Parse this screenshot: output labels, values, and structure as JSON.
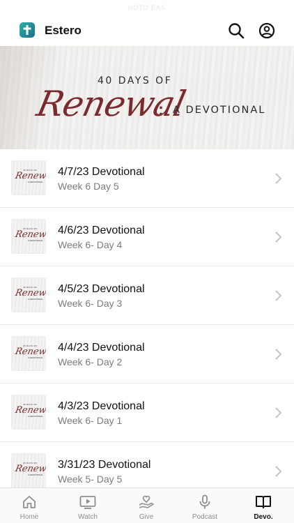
{
  "status_bar": {
    "text": "HOTO EAS"
  },
  "header": {
    "app_title": "Estero",
    "logo_icon": "cross-logo-icon",
    "search_icon": "search-icon",
    "profile_icon": "person-circle-icon"
  },
  "hero": {
    "top_text": "40 DAYS OF",
    "script_text": "Renewal",
    "colon": ":",
    "sub_text": "A DEVOTIONAL"
  },
  "thumbnail": {
    "top_text": "40 DAYS OF",
    "script_text": "Renewal",
    "sub_text": "A DEVOTIONAL"
  },
  "devotionals": [
    {
      "title": "4/7/23 Devotional",
      "subtitle": "Week 6 Day 5"
    },
    {
      "title": "4/6/23 Devotional",
      "subtitle": "Week 6- Day 4"
    },
    {
      "title": "4/5/23 Devotional",
      "subtitle": "Week 6- Day 3"
    },
    {
      "title": "4/4/23 Devotional",
      "subtitle": "Week 6- Day 2"
    },
    {
      "title": "4/3/23 Devotional",
      "subtitle": "Week 6- Day 1"
    },
    {
      "title": "3/31/23 Devotional",
      "subtitle": "Week 5- Day 5"
    }
  ],
  "tabs": [
    {
      "label": "Home",
      "icon": "home-icon",
      "active": false
    },
    {
      "label": "Watch",
      "icon": "video-play-icon",
      "active": false
    },
    {
      "label": "Give",
      "icon": "giving-hand-heart-icon",
      "active": false
    },
    {
      "label": "Podcast",
      "icon": "microphone-icon",
      "active": false
    },
    {
      "label": "Devo.",
      "icon": "open-book-icon",
      "active": true
    }
  ],
  "colors": {
    "accent_script": "#7b2a30",
    "logo_gradient_start": "#2bb3a5",
    "logo_gradient_end": "#1b6c8a",
    "subtitle_gray": "#7c7c7c"
  }
}
